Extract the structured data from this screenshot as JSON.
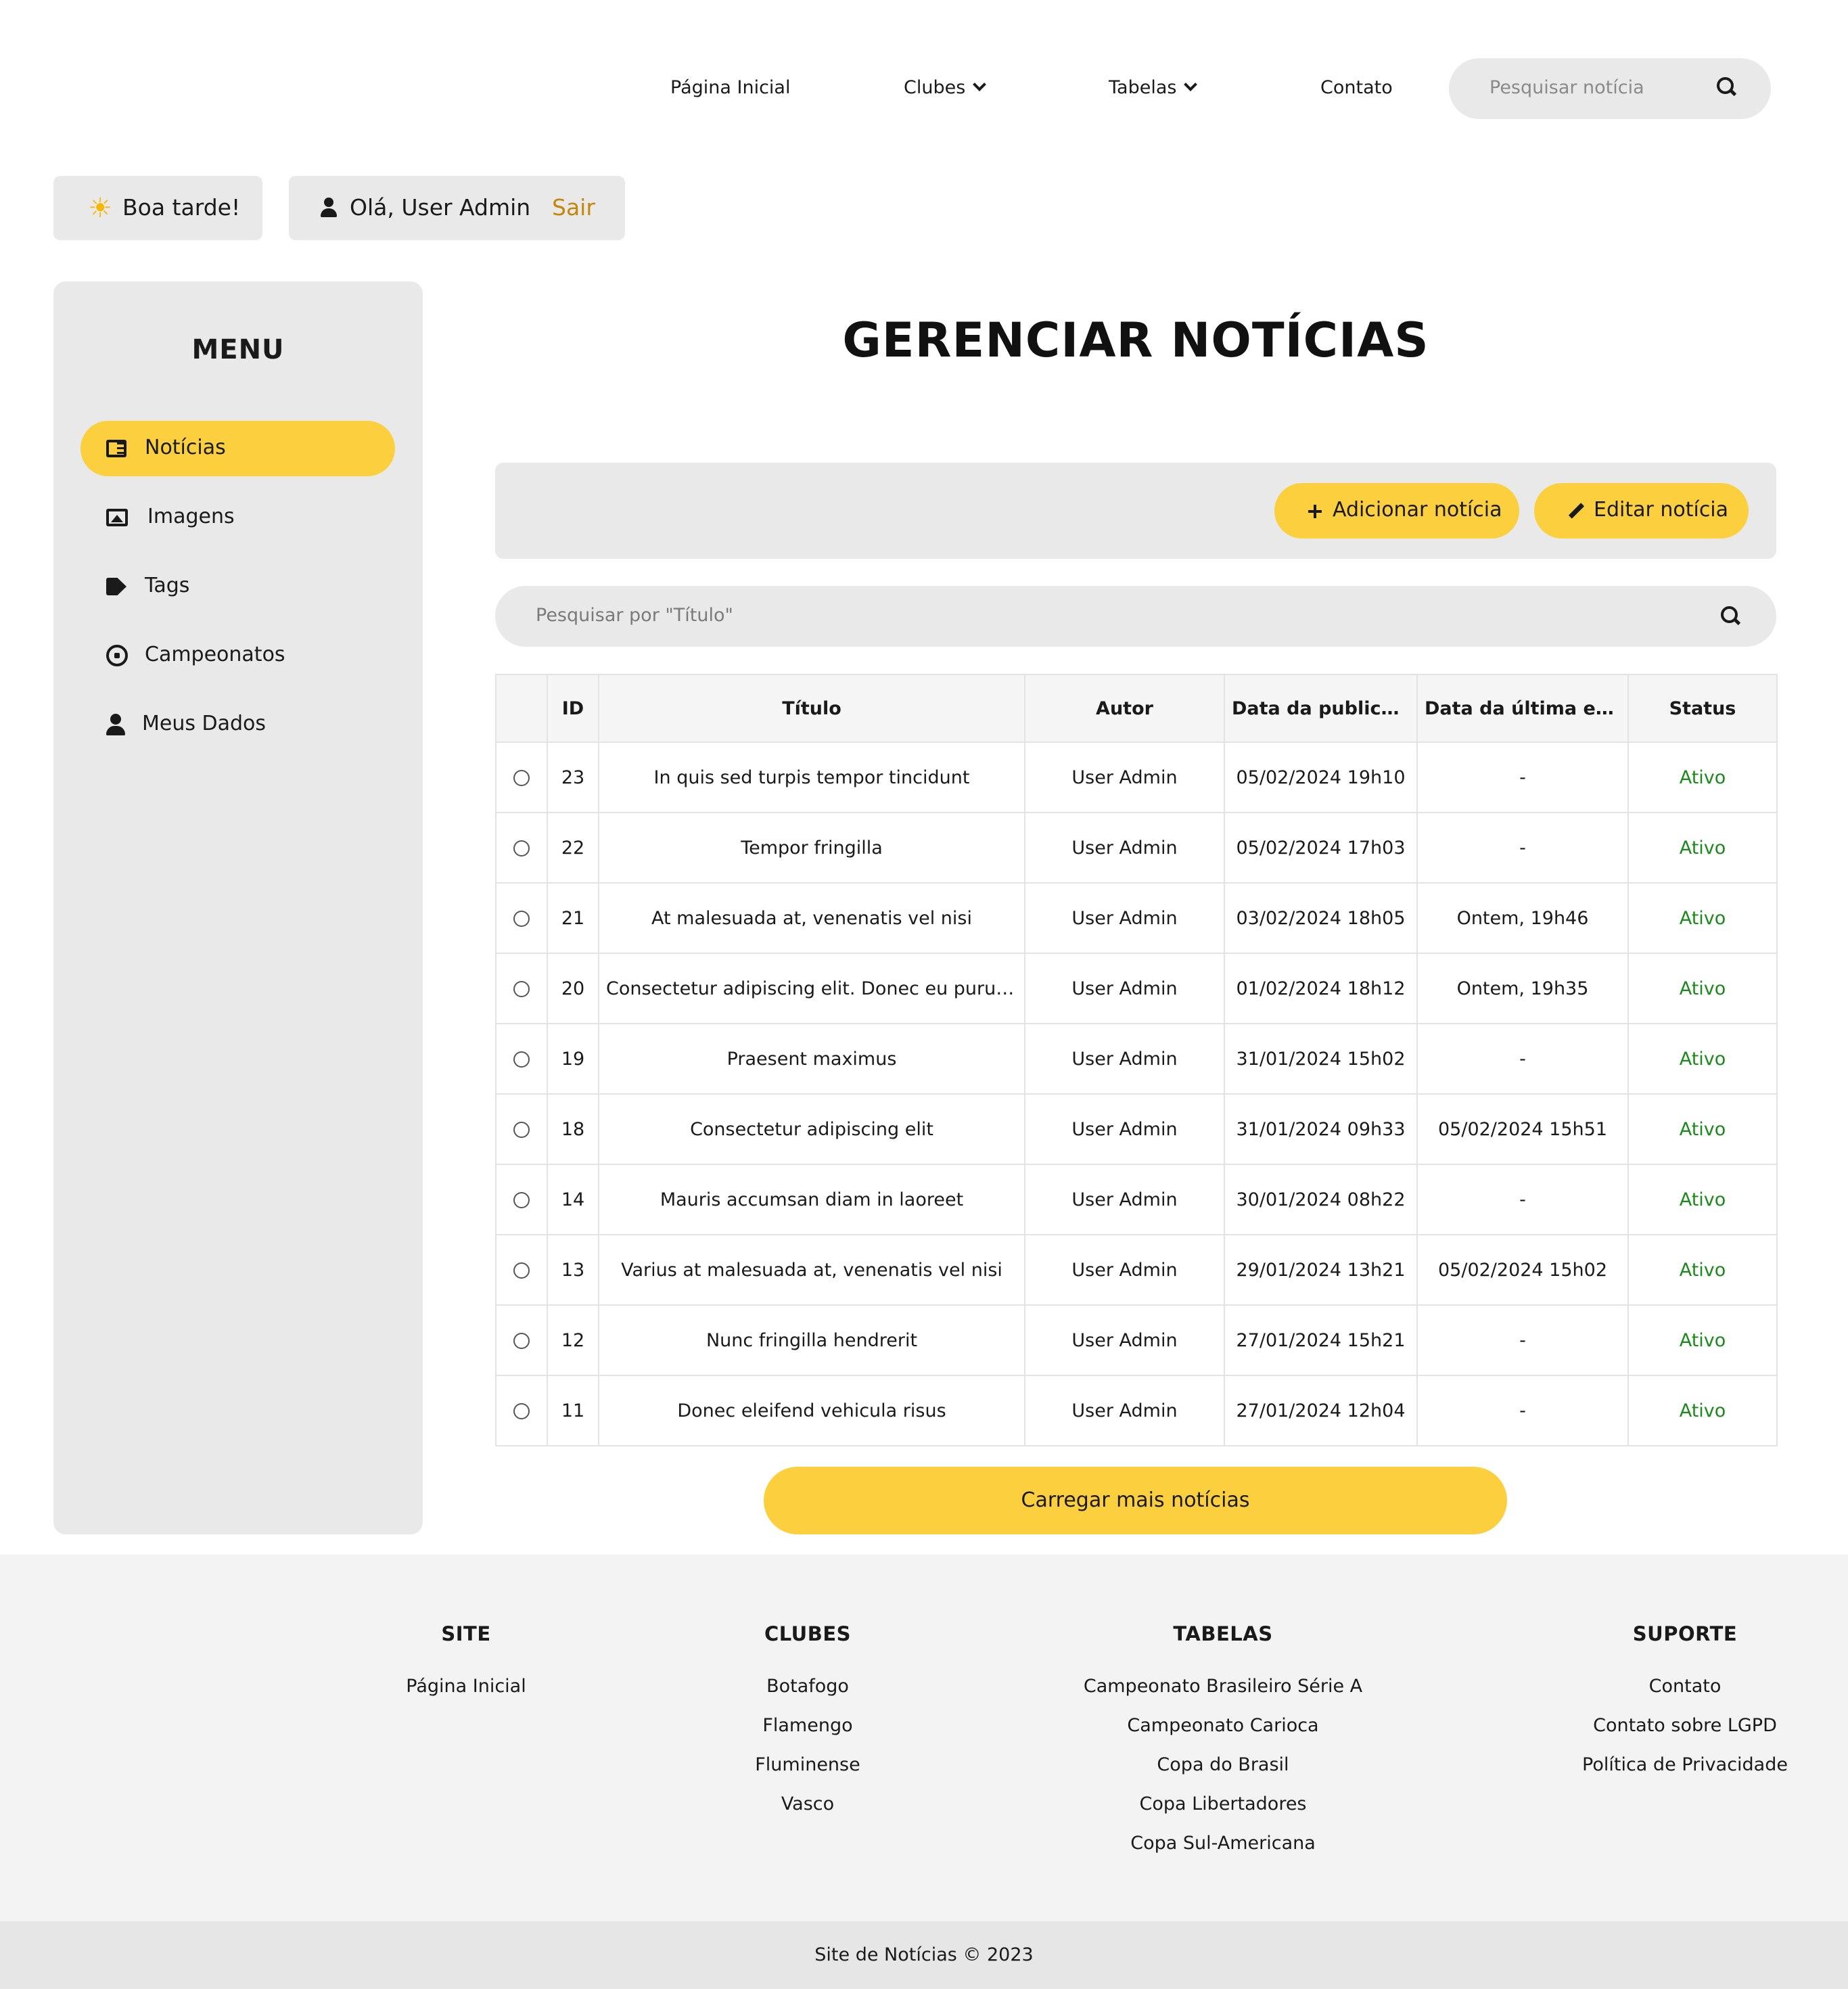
{
  "nav": {
    "home": "Página Inicial",
    "clubs": "Clubes",
    "tables": "Tabelas",
    "contact": "Contato",
    "search_placeholder": "Pesquisar notícia"
  },
  "greeting": {
    "text": "Boa tarde!",
    "user": "Olá, User Admin",
    "logout": "Sair"
  },
  "sidebar": {
    "title": "MENU",
    "items": [
      {
        "label": "Notícias",
        "icon": "newspaper-icon",
        "active": true
      },
      {
        "label": "Imagens",
        "icon": "image-icon"
      },
      {
        "label": "Tags",
        "icon": "tags-icon"
      },
      {
        "label": "Campeonatos",
        "icon": "soccer-ball-icon"
      },
      {
        "label": "Meus Dados",
        "icon": "user-icon"
      }
    ]
  },
  "main": {
    "title": "GERENCIAR NOTÍCIAS",
    "add_button": "Adicionar notícia",
    "edit_button": "Editar notícia",
    "search_placeholder": "Pesquisar por \"Título\"",
    "load_more": "Carregar mais notícias"
  },
  "table": {
    "headers": [
      "ID",
      "Título",
      "Autor",
      "Data da publicação",
      "Data da última edição",
      "Status"
    ],
    "rows": [
      {
        "id": "23",
        "title": "In quis sed turpis tempor tincidunt",
        "author": "User Admin",
        "published": "05/02/2024 19h10",
        "edited": "-",
        "status": "Ativo"
      },
      {
        "id": "22",
        "title": "Tempor fringilla",
        "author": "User Admin",
        "published": "05/02/2024 17h03",
        "edited": "-",
        "status": "Ativo"
      },
      {
        "id": "21",
        "title": "At malesuada at, venenatis vel nisi",
        "author": "User Admin",
        "published": "03/02/2024 18h05",
        "edited": "Ontem, 19h46",
        "status": "Ativo"
      },
      {
        "id": "20",
        "title": "Consectetur adipiscing elit. Donec eu purus et ...",
        "author": "User Admin",
        "published": "01/02/2024 18h12",
        "edited": "Ontem, 19h35",
        "status": "Ativo"
      },
      {
        "id": "19",
        "title": "Praesent maximus",
        "author": "User Admin",
        "published": "31/01/2024 15h02",
        "edited": "-",
        "status": "Ativo"
      },
      {
        "id": "18",
        "title": "Consectetur adipiscing elit",
        "author": "User Admin",
        "published": "31/01/2024 09h33",
        "edited": "05/02/2024 15h51",
        "status": "Ativo"
      },
      {
        "id": "14",
        "title": "Mauris accumsan diam in laoreet",
        "author": "User Admin",
        "published": "30/01/2024 08h22",
        "edited": "-",
        "status": "Ativo"
      },
      {
        "id": "13",
        "title": "Varius at malesuada at, venenatis vel nisi",
        "author": "User Admin",
        "published": "29/01/2024 13h21",
        "edited": "05/02/2024 15h02",
        "status": "Ativo"
      },
      {
        "id": "12",
        "title": "Nunc fringilla hendrerit",
        "author": "User Admin",
        "published": "27/01/2024 15h21",
        "edited": "-",
        "status": "Ativo"
      },
      {
        "id": "11",
        "title": "Donec eleifend vehicula risus",
        "author": "User Admin",
        "published": "27/01/2024 12h04",
        "edited": "-",
        "status": "Ativo"
      }
    ]
  },
  "footer": {
    "columns": [
      {
        "title": "SITE",
        "links": [
          "Página Inicial"
        ]
      },
      {
        "title": "CLUBES",
        "links": [
          "Botafogo",
          "Flamengo",
          "Fluminense",
          "Vasco"
        ]
      },
      {
        "title": "TABELAS",
        "links": [
          "Campeonato Brasileiro Série A",
          "Campeonato Carioca",
          "Copa do Brasil",
          "Copa Libertadores",
          "Copa Sul-Americana"
        ]
      },
      {
        "title": "SUPORTE",
        "links": [
          "Contato",
          "Contato sobre LGPD",
          "Política de Privacidade"
        ]
      }
    ],
    "copyright": "Site de Notícias © 2023"
  },
  "colors": {
    "accent": "#fbcf3e",
    "panel": "#e9e9e9",
    "status_active": "#1a8a1a",
    "logout": "#c5870b"
  }
}
